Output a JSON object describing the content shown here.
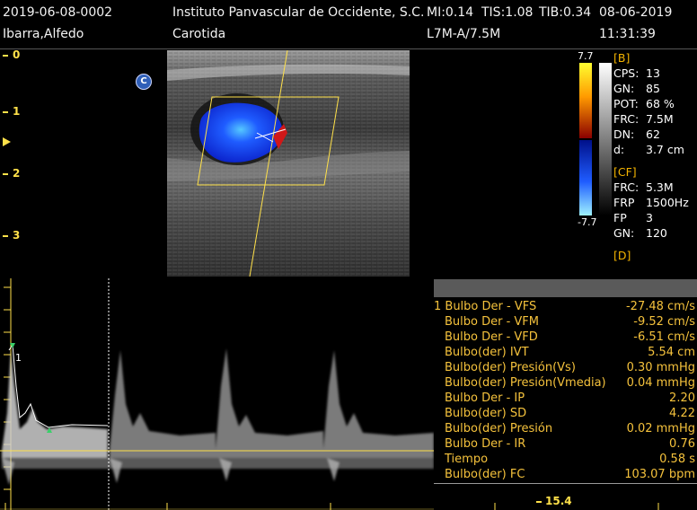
{
  "header": {
    "date_id": "2019-06-08-0002",
    "institution": "Instituto Panvascular de Occidente, S.C.",
    "mi": "MI:0.14",
    "tis": "TIS:1.08",
    "tib": "TIB:0.34",
    "date": "08-06-2019",
    "patient": "Ibarra,Alfedo",
    "study": "Carotida",
    "probe": "L7M-A/7.5M",
    "time": "11:31:39"
  },
  "depth_scale": [
    "0",
    "1",
    "2",
    "3"
  ],
  "badge": "C",
  "color_scale": {
    "max": "7.7",
    "min": "-7.7"
  },
  "params": {
    "b_title": "[B]",
    "b_rows": [
      {
        "k": "CPS:",
        "v": "13"
      },
      {
        "k": "GN:",
        "v": "85"
      },
      {
        "k": "POT:",
        "v": "68 %"
      },
      {
        "k": "FRC:",
        "v": "7.5M"
      },
      {
        "k": "DN:",
        "v": "62"
      },
      {
        "k": "d:",
        "v": "3.7 cm"
      }
    ],
    "cf_title": "[CF]",
    "cf_rows": [
      {
        "k": "FRC:",
        "v": "5.3M"
      },
      {
        "k": "FRP",
        "v": "1500Hz"
      },
      {
        "k": "FP",
        "v": "3"
      },
      {
        "k": "GN:",
        "v": "120"
      }
    ],
    "d_title": "[D]"
  },
  "measurements": [
    {
      "label": "1 Bulbo Der - VFS",
      "value": "-27.48 cm/s"
    },
    {
      "label": "Bulbo Der - VFM",
      "value": "-9.52 cm/s"
    },
    {
      "label": "Bulbo Der - VFD",
      "value": "-6.51 cm/s"
    },
    {
      "label": "Bulbo(der) IVT",
      "value": "5.54 cm"
    },
    {
      "label": "Bulbo(der) Presión(Vs)",
      "value": "0.30 mmHg"
    },
    {
      "label": "Bulbo(der) Presión(Vmedia)",
      "value": "0.04 mmHg"
    },
    {
      "label": "Bulbo Der - IP",
      "value": "2.20"
    },
    {
      "label": "Bulbo(der) SD",
      "value": "4.22"
    },
    {
      "label": "Bulbo(der) Presión",
      "value": "0.02 mmHg"
    },
    {
      "label": "Bulbo Der - IR",
      "value": "0.76"
    },
    {
      "label": "Tiempo",
      "value": "0.58 s"
    },
    {
      "label": "Bulbo(der) FC",
      "value": "103.07 bpm"
    }
  ],
  "doppler": {
    "cursor_label": "1",
    "sweep_speed": "15.4"
  },
  "colors": {
    "yellow": "#ffe14a",
    "orange": "#f5c23c",
    "flow_blue": "#1f5cff",
    "flow_red": "#d01818"
  }
}
